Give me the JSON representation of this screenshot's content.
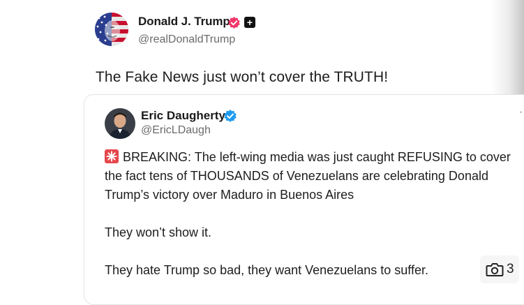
{
  "post": {
    "author_name": "Donald J. Trump",
    "author_handle": "@realDonaldTrump",
    "plus_badge": "+",
    "text": "The Fake News just won’t cover the TRUTH!"
  },
  "quoted_post": {
    "author_name": "Eric Daugherty",
    "author_handle": "@EricLDaugh",
    "more_glyph": "·",
    "paragraphs": {
      "p1_line1": "BREAKING: The left-wing media was just caught REFUSING to cover",
      "p1_line2": "the fact tens of THOUSANDS of Venezuelans are celebrating Donald",
      "p1_line3": "Trump’s victory over Maduro in Buenos Aires",
      "p2": "They won’t show it.",
      "p3": "They hate Trump so bad, they want Venezuelans to suffer."
    }
  },
  "media": {
    "photo_count": "3"
  },
  "colors": {
    "verified_pink": "#f0386b",
    "verified_blue": "#1d9bf0",
    "siren_red": "#e5474c"
  }
}
